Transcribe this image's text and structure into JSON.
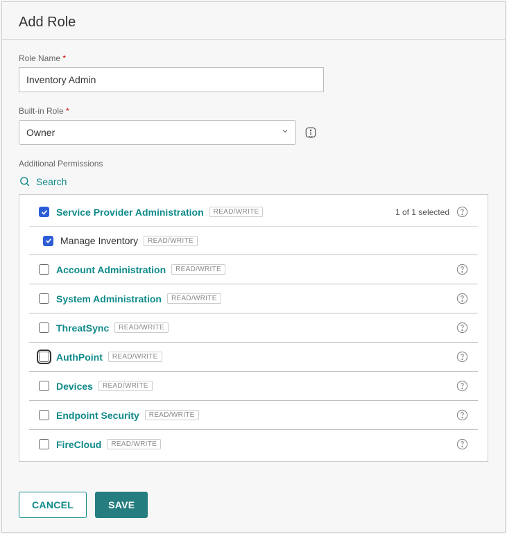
{
  "header": {
    "title": "Add Role"
  },
  "form": {
    "roleName": {
      "label": "Role Name",
      "value": "Inventory Admin"
    },
    "builtInRole": {
      "label": "Built-in Role",
      "value": "Owner"
    },
    "additional": {
      "label": "Additional Permissions"
    },
    "search": {
      "label": "Search"
    }
  },
  "badgeText": "READ/WRITE",
  "selectedText": "1 of 1 selected",
  "perms": {
    "spAdmin": "Service Provider Administration",
    "manageInv": "Manage Inventory",
    "accountAdmin": "Account Administration",
    "sysAdmin": "System Administration",
    "threatSync": "ThreatSync",
    "authPoint": "AuthPoint",
    "devices": "Devices",
    "endpointSec": "Endpoint Security",
    "fireCloud": "FireCloud"
  },
  "buttons": {
    "cancel": "CANCEL",
    "save": "SAVE"
  }
}
